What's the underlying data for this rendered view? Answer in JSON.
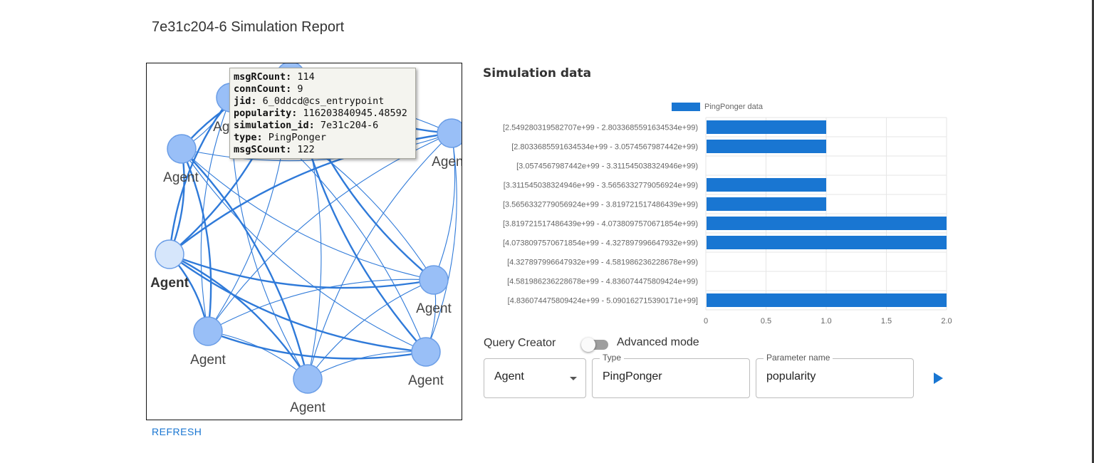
{
  "report": {
    "title": "7e31c204-6 Simulation Report",
    "refresh_label": "REFRESH"
  },
  "graph": {
    "node_label": "Agent",
    "tooltip": [
      {
        "key": "msgRCount:",
        "value": "114"
      },
      {
        "key": "connCount:",
        "value": "9"
      },
      {
        "key": "jid:",
        "value": "6_0ddcd@cs_entrypoint"
      },
      {
        "key": "popularity:",
        "value": "116203840945.48592"
      },
      {
        "key": "simulation_id:",
        "value": "7e31c204-6"
      },
      {
        "key": "type:",
        "value": "PingPonger"
      },
      {
        "key": "msgSCount:",
        "value": "122"
      }
    ]
  },
  "simulation": {
    "heading": "Simulation data"
  },
  "chart_data": {
    "type": "bar",
    "orientation": "horizontal",
    "legend_position": "top",
    "series": [
      {
        "name": "PingPonger data",
        "color": "#1976d2",
        "values": [
          1,
          1,
          0,
          1,
          1,
          2,
          2,
          0,
          0,
          2
        ]
      }
    ],
    "categories": [
      "[2.549280319582707e+99 - 2.8033685591634534e+99)",
      "[2.8033685591634534e+99 - 3.0574567987442e+99)",
      "[3.0574567987442e+99 - 3.311545038324946e+99)",
      "[3.311545038324946e+99 - 3.5656332779056924e+99)",
      "[3.5656332779056924e+99 - 3.819721517486439e+99)",
      "[3.819721517486439e+99 - 4.0738097570671854e+99)",
      "[4.0738097570671854e+99 - 4.327897996647932e+99)",
      "[4.327897996647932e+99 - 4.581986236228678e+99)",
      "[4.581986236228678e+99 - 4.836074475809424e+99)",
      "[4.836074475809424e+99 - 5.090162715390171e+99]"
    ],
    "xlim": [
      0,
      2
    ],
    "xticks": [
      "0",
      "0.5",
      "1.0",
      "1.5",
      "2.0"
    ],
    "grid": true
  },
  "query": {
    "label": "Query Creator",
    "advanced_label": "Advanced mode",
    "advanced_enabled": false,
    "entity_value": "Agent",
    "type_legend": "Type",
    "type_value": "PingPonger",
    "param_legend": "Parameter name",
    "param_value": "popularity"
  },
  "colors": {
    "accent": "#1976d2",
    "node_fill": "#99bff7",
    "node_selected": "#d6e6fb",
    "edge": "#2f7ad9"
  }
}
